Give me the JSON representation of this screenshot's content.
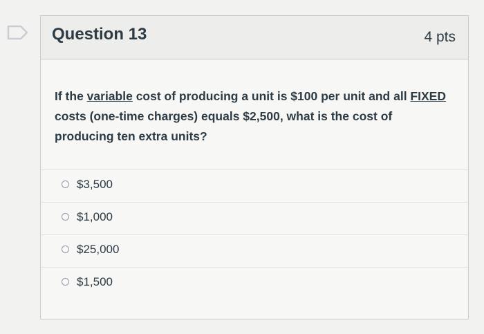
{
  "question": {
    "title": "Question 13",
    "points": "4 pts",
    "text_before": "If the ",
    "underlined_1": "variable",
    "text_middle": " cost of producing a unit is $100 per unit and all ",
    "underlined_2": "FIXED",
    "text_after": " costs (one-time charges) equals $2,500, what is the cost of producing ten extra units?"
  },
  "answers": [
    {
      "label": "$3,500"
    },
    {
      "label": "$1,000"
    },
    {
      "label": "$25,000"
    },
    {
      "label": "$1,500"
    }
  ],
  "icons": {
    "flag": "bookmark-flag-icon"
  },
  "colors": {
    "text": "#2d3b45",
    "border": "#c7cdd1",
    "header_bg": "#ededec",
    "flag": "#d9dcde"
  }
}
